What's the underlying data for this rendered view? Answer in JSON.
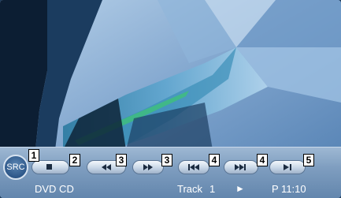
{
  "source_button": {
    "label": "SRC"
  },
  "controls": {
    "callouts": [
      "1",
      "2",
      "3",
      "3",
      "4",
      "4",
      "5"
    ],
    "stop_icon": "stop-icon",
    "rewind_icon": "rewind-icon",
    "fast_forward_icon": "fast-forward-icon",
    "previous_icon": "skip-previous-icon",
    "next_icon": "skip-next-icon",
    "play_pause_icon": "play-pause-icon"
  },
  "status": {
    "source": "DVD CD",
    "track_label": "Track",
    "track_number": "1",
    "play_symbol": "►",
    "time": "P 11:10"
  },
  "colors": {
    "bar": "#7f9ec0",
    "accent": "#2d5789"
  }
}
